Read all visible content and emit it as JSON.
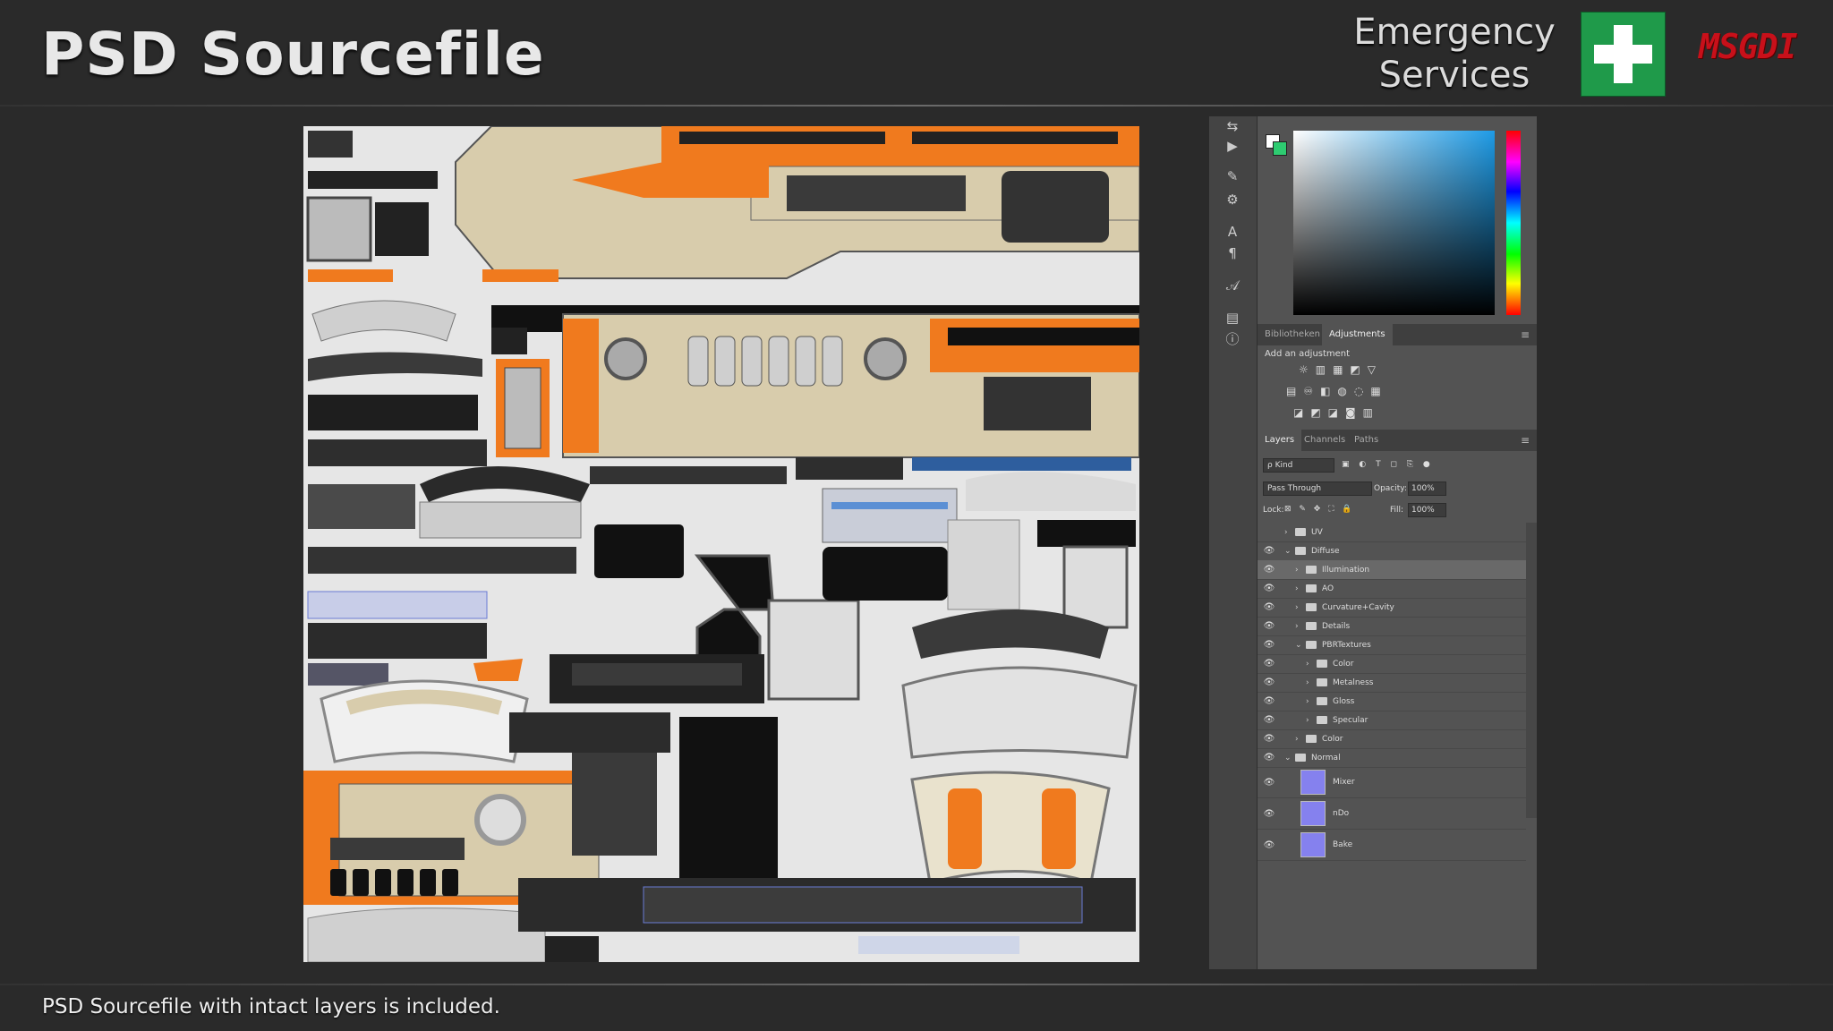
{
  "header": {
    "title": "PSD Sourcefile",
    "brand_line1": "Emergency",
    "brand_line2": "Services",
    "logo_text": "MSGDI"
  },
  "footer": {
    "caption": "PSD Sourcefile with intact layers is included."
  },
  "colors": {
    "background": "#2a2a2a",
    "accent_orange": "#f07a1e",
    "cross_green": "#1f9a4a",
    "logo_red": "#c8101a",
    "panel_gray": "#535353",
    "layer_thumb": "#8581ee"
  },
  "toolbar": {
    "icons": [
      "history-icon",
      "play-icon",
      "brush-settings-icon",
      "properties-icon",
      "character-icon",
      "paragraph-icon",
      "glyphs-icon",
      "layer-comps-icon",
      "info-icon"
    ]
  },
  "color_picker": {
    "foreground": "#ffffff",
    "background": "#2ecc71",
    "hue_base": "#1e9be6"
  },
  "panel_tabs_top": {
    "tab1": "Bibliotheken",
    "tab2": "Adjustments",
    "menu": "≡"
  },
  "adjustments": {
    "label": "Add an adjustment",
    "row1": "☼▥▦◩▽",
    "row2": "▤♾◧◍◌▦",
    "row3": "◪◩◪◙▥"
  },
  "panel_tabs_layers": {
    "tab1": "Layers",
    "tab2": "Channels",
    "tab3": "Paths",
    "menu": "≡"
  },
  "layer_controls": {
    "kind": "ρ Kind",
    "filter_icons": "▣ ◐ T ◻ ⎘ ●",
    "blend_mode": "Pass Through",
    "opacity_label": "Opacity:",
    "opacity_value": "100%",
    "lock_label": "Lock:",
    "lock_icons": "⊠ ✎ ✥ ⛶ 🔒",
    "fill_label": "Fill:",
    "fill_value": "100%"
  },
  "layers": [
    {
      "name": "UV",
      "type": "folder",
      "depth": 0,
      "expanded": false,
      "visible": false
    },
    {
      "name": "Diffuse",
      "type": "folder",
      "depth": 0,
      "expanded": true,
      "visible": true
    },
    {
      "name": "Illumination",
      "type": "folder",
      "depth": 1,
      "expanded": false,
      "visible": true,
      "selected": true
    },
    {
      "name": "AO",
      "type": "folder",
      "depth": 1,
      "expanded": false,
      "visible": true
    },
    {
      "name": "Curvature+Cavity",
      "type": "folder",
      "depth": 1,
      "expanded": false,
      "visible": true
    },
    {
      "name": "Details",
      "type": "folder",
      "depth": 1,
      "expanded": false,
      "visible": true
    },
    {
      "name": "PBRTextures",
      "type": "folder",
      "depth": 1,
      "expanded": true,
      "visible": true
    },
    {
      "name": "Color",
      "type": "folder",
      "depth": 2,
      "expanded": false,
      "visible": true
    },
    {
      "name": "Metalness",
      "type": "folder",
      "depth": 2,
      "expanded": false,
      "visible": true
    },
    {
      "name": "Gloss",
      "type": "folder",
      "depth": 2,
      "expanded": false,
      "visible": true
    },
    {
      "name": "Specular",
      "type": "folder",
      "depth": 2,
      "expanded": false,
      "visible": true
    },
    {
      "name": "Color",
      "type": "folder",
      "depth": 1,
      "expanded": false,
      "visible": true
    },
    {
      "name": "Normal",
      "type": "folder",
      "depth": 0,
      "expanded": true,
      "visible": true
    },
    {
      "name": "Mixer",
      "type": "image",
      "depth": 1,
      "visible": true
    },
    {
      "name": "nDo",
      "type": "image",
      "depth": 1,
      "visible": true
    },
    {
      "name": "Bake",
      "type": "image",
      "depth": 1,
      "visible": true
    }
  ]
}
